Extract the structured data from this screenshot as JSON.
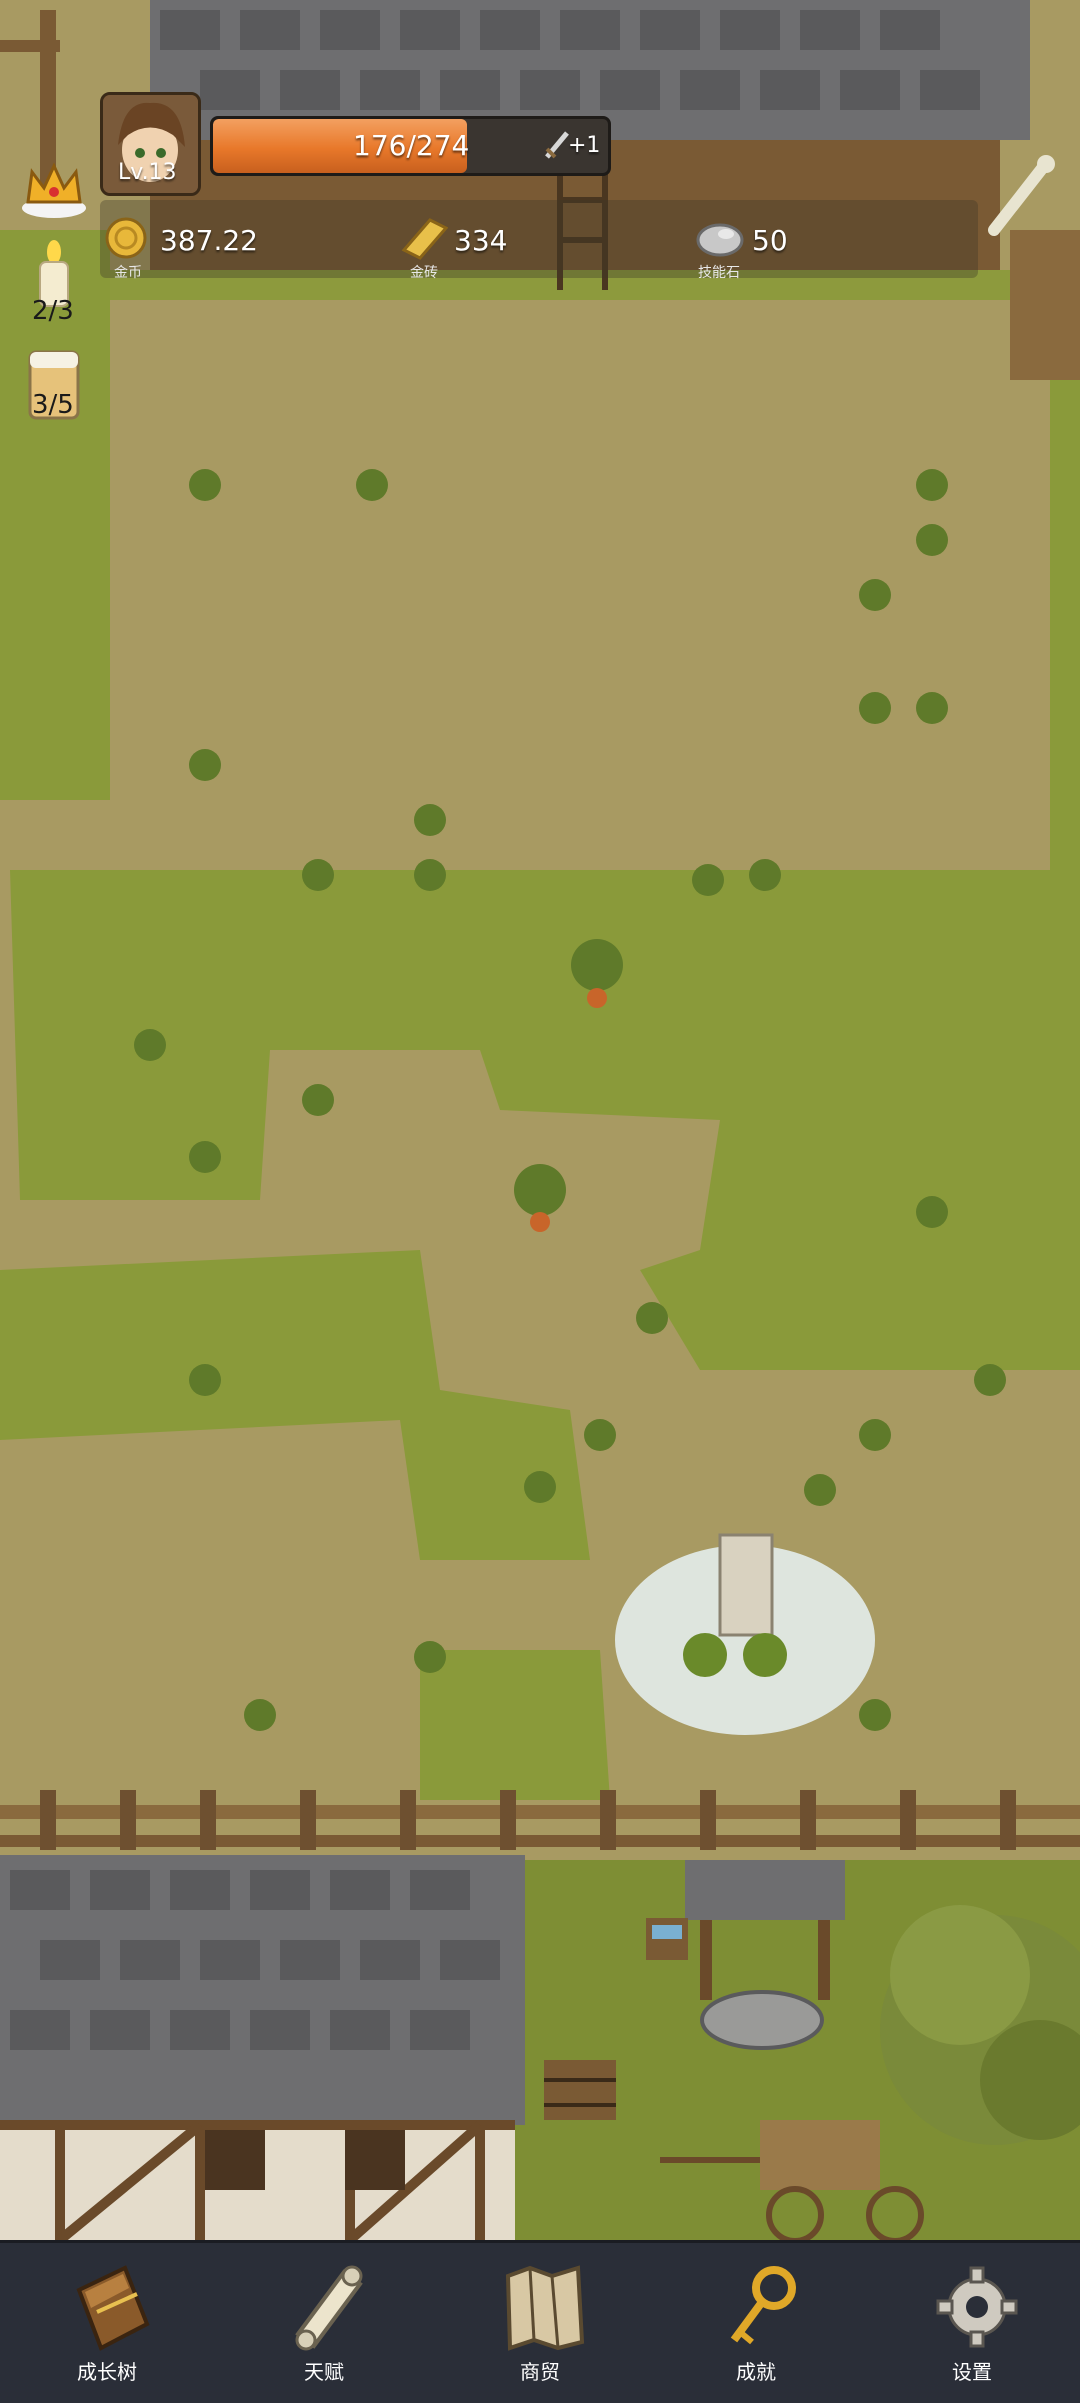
{
  "player": {
    "level": "Lv.13",
    "hp_text": "176/274",
    "hp_fraction": 0.642,
    "bonus": "+1"
  },
  "resources": [
    {
      "id": "gold",
      "value": "387.22",
      "label": "金币",
      "icon": "gold-coin-icon"
    },
    {
      "id": "gold-brick",
      "value": "334",
      "label": "金砖",
      "icon": "gold-brick-icon"
    },
    {
      "id": "skill-stone",
      "value": "50",
      "label": "技能石",
      "icon": "skill-stone-icon"
    }
  ],
  "side_counters": {
    "candle": "2/3",
    "beer": "3/5"
  },
  "nav": [
    {
      "label": "成长树",
      "icon": "book-icon"
    },
    {
      "label": "天赋",
      "icon": "scroll-icon"
    },
    {
      "label": "商贸",
      "icon": "map-icon"
    },
    {
      "label": "成就",
      "icon": "key-icon"
    },
    {
      "label": "设置",
      "icon": "gear-icon"
    }
  ],
  "colors": {
    "dirt": "#a89a62",
    "grass": "#8a9a3a",
    "hp_fill": "#e8782a",
    "navbar": "#2a2e38"
  }
}
